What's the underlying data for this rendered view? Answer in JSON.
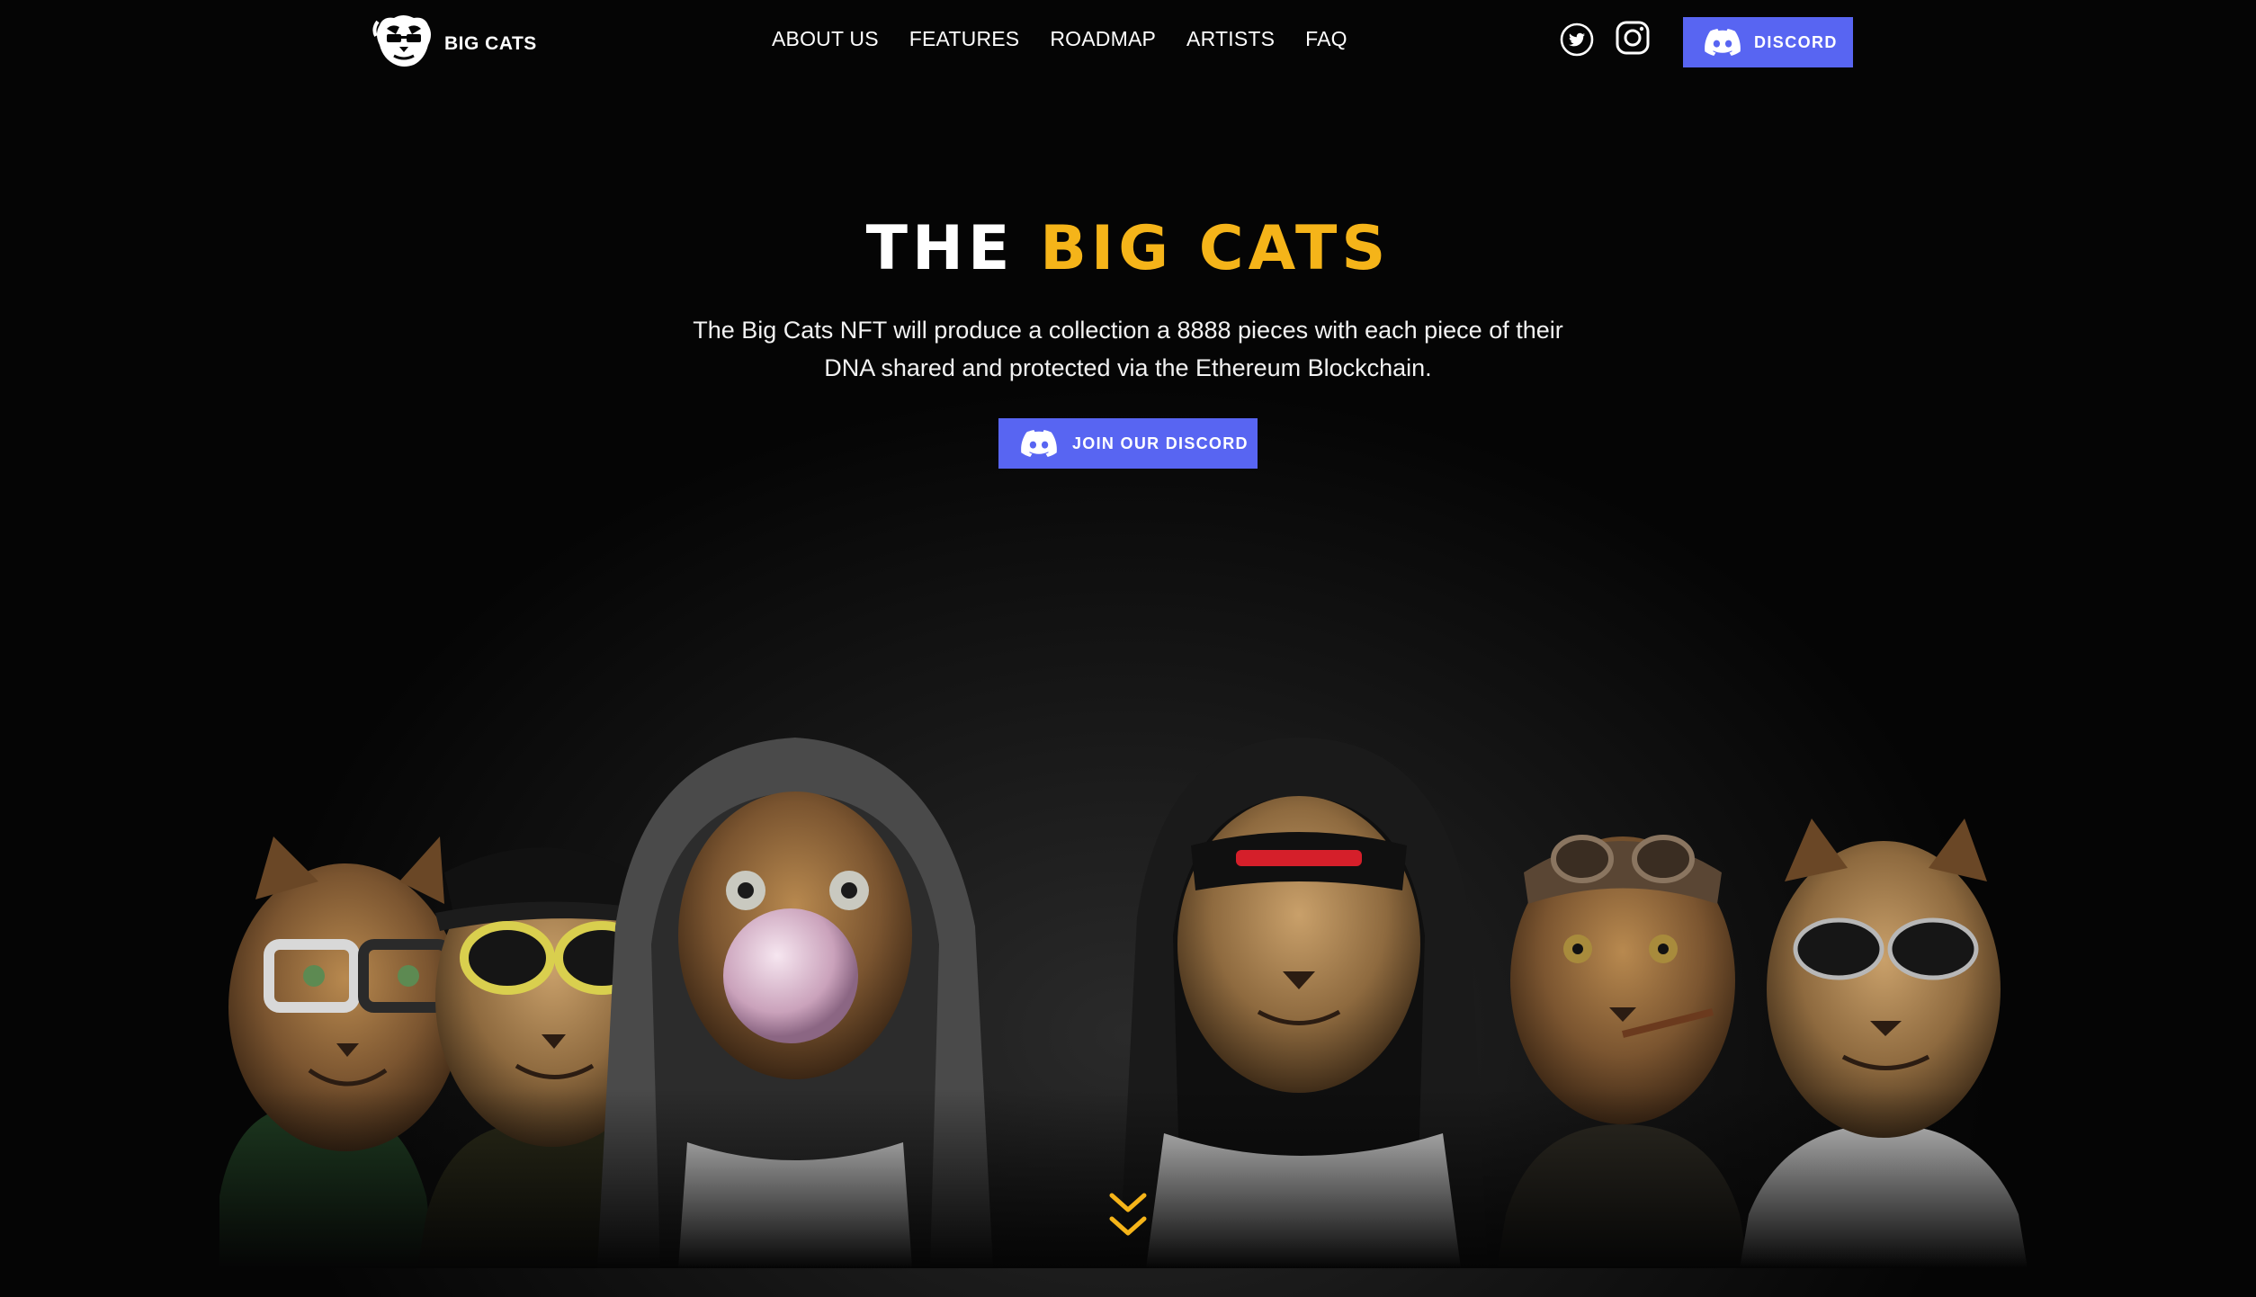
{
  "brand": {
    "name": "BIG CATS",
    "logo_icon": "cat-head-logo-icon"
  },
  "nav": {
    "items": [
      {
        "label": "ABOUT US"
      },
      {
        "label": "FEATURES"
      },
      {
        "label": "ROADMAP"
      },
      {
        "label": "ARTISTS"
      },
      {
        "label": "FAQ"
      }
    ],
    "social": [
      "twitter-icon",
      "instagram-icon"
    ],
    "discord_label": "DISCORD"
  },
  "hero": {
    "title_prefix": "THE",
    "title_accent": "BIG CATS",
    "description": "The Big Cats NFT will produce a collection a 8888 pieces with each piece of their DNA shared and protected via the Ethereum Blockchain.",
    "cta_label": "JOIN OUR DISCORD"
  },
  "colors": {
    "accent": "#f5b419",
    "discord": "#5865f2",
    "background": "#050505"
  }
}
